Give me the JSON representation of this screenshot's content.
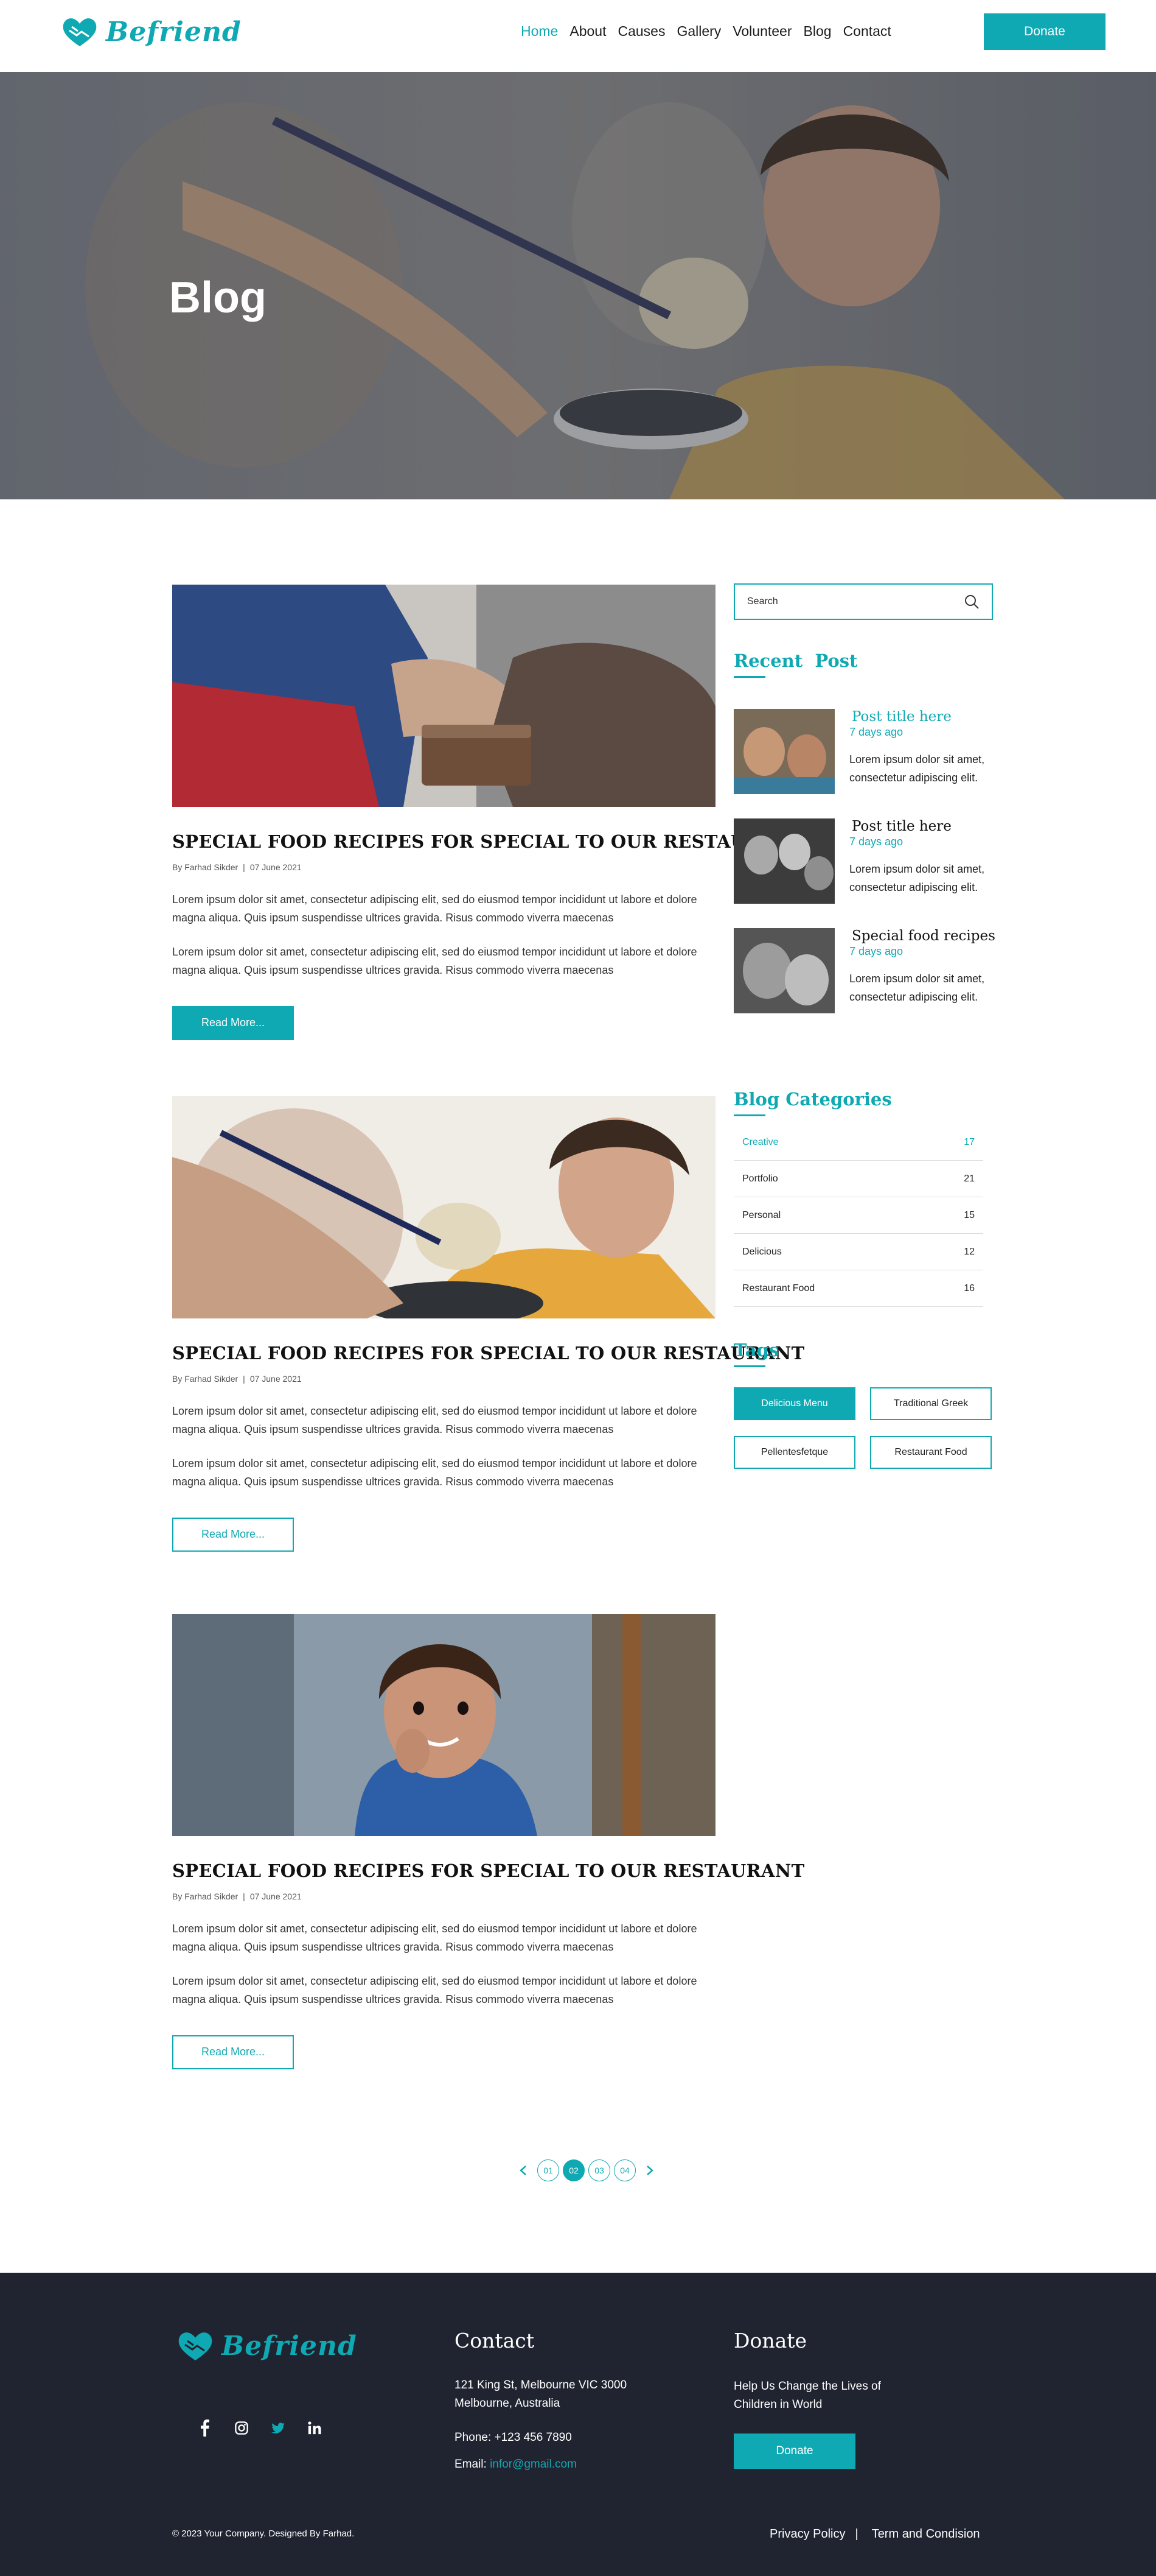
{
  "brand": {
    "name": "Befriend",
    "color": "#0fa9b3",
    "dark": "#1f2430"
  },
  "nav": {
    "items": [
      {
        "label": "Home",
        "active": true
      },
      {
        "label": "About"
      },
      {
        "label": "Causes"
      },
      {
        "label": "Gallery"
      },
      {
        "label": "Volunteer"
      },
      {
        "label": "Blog"
      },
      {
        "label": "Contact"
      }
    ],
    "donate": "Donate"
  },
  "hero": {
    "title": "Blog"
  },
  "posts": [
    {
      "title": "SPECIAL FOOD RECIPES FOR SPECIAL TO OUR RESTAURANT",
      "author": "By Farhad Sikder",
      "date": "07 June 2021",
      "para1": "Lorem ipsum dolor sit amet, consectetur adipiscing elit, sed do eiusmod tempor incididunt ut labore et dolore magna aliqua. Quis ipsum suspendisse ultrices gravida. Risus commodo viverra maecenas",
      "para2": "Lorem ipsum dolor sit amet, consectetur adipiscing elit, sed do eiusmod tempor incididunt ut labore et dolore magna aliqua. Quis ipsum suspendisse ultrices gravida. Risus commodo viverra maecenas",
      "button": "Read More..."
    },
    {
      "title": "SPECIAL FOOD RECIPES FOR SPECIAL TO OUR RESTAURANT",
      "author": "By Farhad Sikder",
      "date": "07 June 2021",
      "para1": "Lorem ipsum dolor sit amet, consectetur adipiscing elit, sed do eiusmod tempor incididunt ut labore et dolore magna aliqua. Quis ipsum suspendisse ultrices gravida. Risus commodo viverra maecenas",
      "para2": "Lorem ipsum dolor sit amet, consectetur adipiscing elit, sed do eiusmod tempor incididunt ut labore et dolore magna aliqua. Quis ipsum suspendisse ultrices gravida. Risus commodo viverra maecenas",
      "button": "Read More..."
    },
    {
      "title": "SPECIAL FOOD RECIPES FOR SPECIAL TO OUR RESTAURANT",
      "author": "By Farhad Sikder",
      "date": "07 June 2021",
      "para1": "Lorem ipsum dolor sit amet, consectetur adipiscing elit, sed do eiusmod tempor incididunt ut labore et dolore magna aliqua. Quis ipsum suspendisse ultrices gravida. Risus commodo viverra maecenas",
      "para2": "Lorem ipsum dolor sit amet, consectetur adipiscing elit, sed do eiusmod tempor incididunt ut labore et dolore magna aliqua. Quis ipsum suspendisse ultrices gravida. Risus commodo viverra maecenas",
      "button": "Read More..."
    }
  ],
  "sidebar": {
    "search_placeholder": "Search",
    "recent_heading": "Recent  Post",
    "recent": [
      {
        "title": "Post title here",
        "date": "7 days ago",
        "excerpt": "Lorem ipsum dolor sit amet, consectetur adipiscing elit."
      },
      {
        "title": "Post title here",
        "date": "7 days ago",
        "excerpt": "Lorem ipsum dolor sit amet, consectetur adipiscing elit."
      },
      {
        "title": "Special food recipes",
        "date": "7 days ago",
        "excerpt": "Lorem ipsum dolor sit amet, consectetur adipiscing elit."
      }
    ],
    "categories_heading": "Blog Categories",
    "categories": [
      {
        "name": "Creative",
        "count": "17"
      },
      {
        "name": "Portfolio",
        "count": "21"
      },
      {
        "name": "Personal",
        "count": "15"
      },
      {
        "name": "Delicious",
        "count": "12"
      },
      {
        "name": "Restaurant Food",
        "count": "16"
      }
    ],
    "tags_heading": "Tags",
    "tags": [
      "Delicious Menu",
      "Traditional Greek",
      "Pellentesfetque",
      "Restaurant Food"
    ]
  },
  "pagination": {
    "pages": [
      "01",
      "02",
      "03",
      "04"
    ],
    "current": "02"
  },
  "footer": {
    "contact_heading": "Contact",
    "address_line1": "121 King St, Melbourne VIC 3000",
    "address_line2": "Melbourne, Australia",
    "phone": "Phone: +123 456 7890",
    "email_label": "Email: ",
    "email": "infor@gmail.com",
    "donate_heading": "Donate",
    "donate_text_line1": "Help Us Change the Lives of",
    "donate_text_line2": "Children in World",
    "donate_button": "Donate",
    "copyright": "© 2023 Your Company. Designed By Farhad.",
    "privacy": "Privacy Policy",
    "terms": "Term and Condision",
    "social": [
      "facebook-icon",
      "instagram-icon",
      "twitter-icon",
      "linkedin-icon"
    ]
  }
}
